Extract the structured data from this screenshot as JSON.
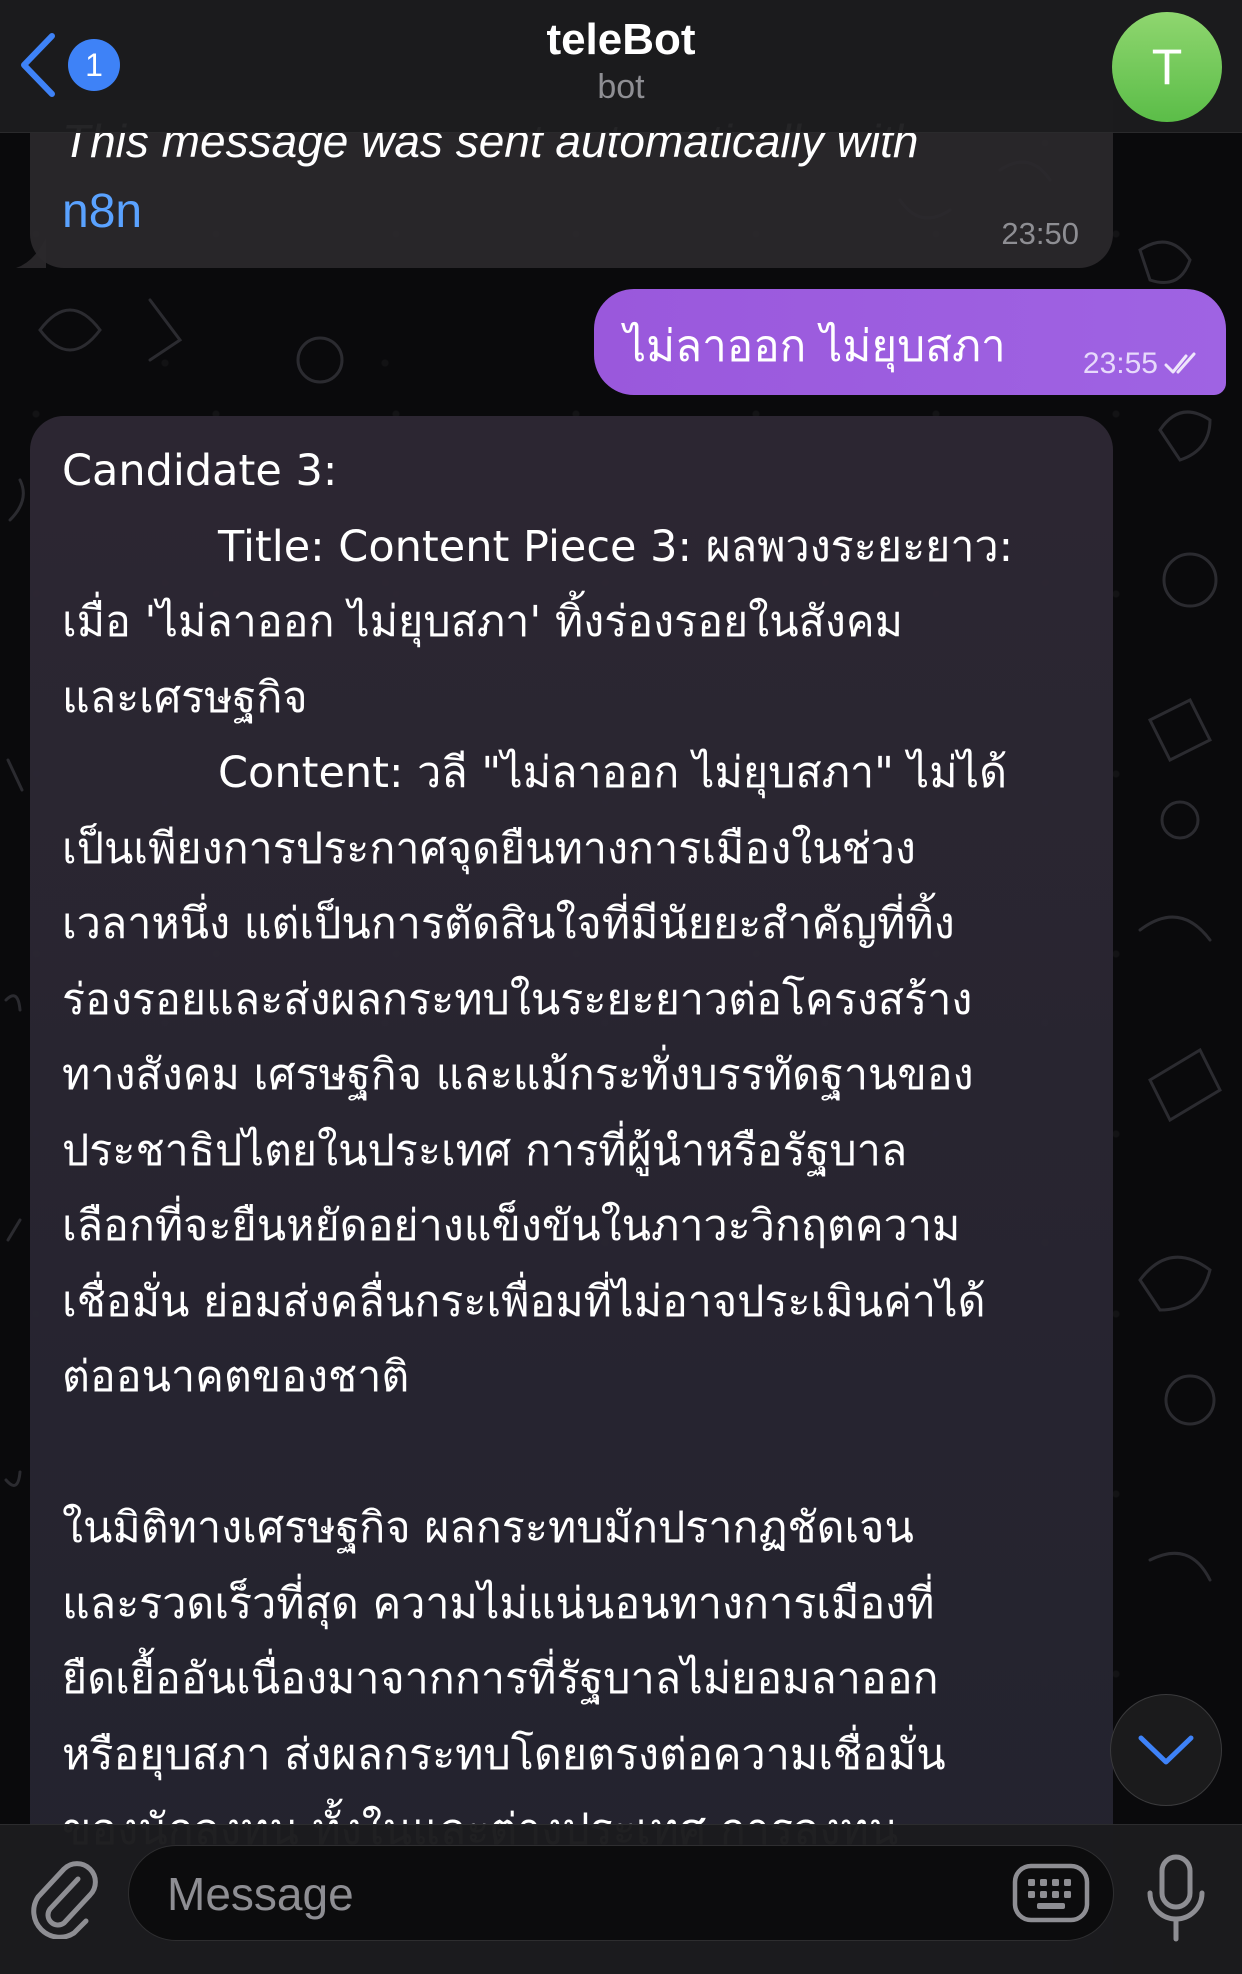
{
  "header": {
    "back_badge": "1",
    "title": "teleBot",
    "subtitle": "bot",
    "avatar_letter": "T"
  },
  "messages": {
    "first": {
      "text": "This message was sent automatically with",
      "link": "n8n",
      "time": "23:50"
    },
    "outgoing": {
      "text": "ไม่ลาออก ไม่ยุบสภา",
      "time": "23:55",
      "status_icon": "double-check-icon"
    },
    "long": {
      "lines": [
        "Candidate 3:",
        "Title: Content Piece 3: ผลพวงระยะยาว:",
        "เมื่อ 'ไม่ลาออก ไม่ยุบสภา' ทิ้งร่องรอยในสังคม",
        "และเศรษฐกิจ",
        "Content: วลี \"ไม่ลาออก ไม่ยุบสภา\" ไม่ได้",
        "เป็นเพียงการประกาศจุดยืนทางการเมืองในช่วง",
        "เวลาหนึ่ง แต่เป็นการตัดสินใจที่มีนัยยะสำคัญที่ทิ้ง",
        "ร่องรอยและส่งผลกระทบในระยะยาวต่อโครงสร้าง",
        "ทางสังคม เศรษฐกิจ และแม้กระทั่งบรรทัดฐานของ",
        "ประชาธิปไตยในประเทศ การที่ผู้นำหรือรัฐบาล",
        "เลือกที่จะยืนหยัดอย่างแข็งขันในภาวะวิกฤตความ",
        "เชื่อมั่น ย่อมส่งคลื่นกระเพื่อมที่ไม่อาจประเมินค่าได้",
        "ต่ออนาคตของชาติ",
        "",
        "ในมิติทางเศรษฐกิจ ผลกระทบมักปรากฏชัดเจน",
        "และรวดเร็วที่สุด ความไม่แน่นอนทางการเมืองที่",
        "ยืดเยื้ออันเนื่องมาจากการที่รัฐบาลไม่ยอมลาออก",
        "หรือยุบสภา ส่งผลกระทบโดยตรงต่อความเชื่อมั่น",
        "ของนักลงทุน ทั้งในและต่างประเทศ การลงทุน"
      ]
    }
  },
  "input": {
    "placeholder": "Message"
  },
  "colors": {
    "accent": "#3e82f7",
    "outgoing_bubble": "#9a58dc",
    "incoming_bubble": "#2a282c",
    "avatar": "#6cc456",
    "link": "#5aa2ff"
  }
}
